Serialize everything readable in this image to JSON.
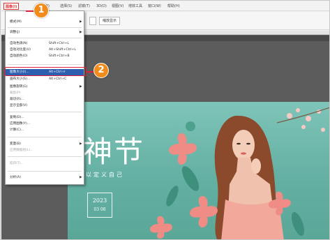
{
  "menubar": {
    "items": [
      {
        "label": "图像(I)",
        "active": true
      },
      {
        "label": "(Y)",
        "active": false
      },
      {
        "label": "选择(S)",
        "active": false
      },
      {
        "label": "滤镜(T)",
        "active": false
      },
      {
        "label": "3D(D)",
        "active": false
      },
      {
        "label": "视图(V)",
        "active": false
      },
      {
        "label": "增效工具",
        "active": false
      },
      {
        "label": "窗口(W)",
        "active": false
      },
      {
        "label": "帮助(H)",
        "active": false
      }
    ]
  },
  "optionsbar": {
    "button1": "",
    "button2": "缩放显示"
  },
  "image_menu": {
    "items": [
      {
        "label": "模式(M)",
        "shortcut": "",
        "submenu": true
      },
      {
        "type": "sep"
      },
      {
        "label": "调整(J)",
        "shortcut": "",
        "submenu": true
      },
      {
        "type": "sep"
      },
      {
        "label": "自动色调(N)",
        "shortcut": "Shift+Ctrl+L"
      },
      {
        "label": "自动对比度(U)",
        "shortcut": "Alt+Shift+Ctrl+L"
      },
      {
        "label": "自动颜色(O)",
        "shortcut": "Shift+Ctrl+B"
      },
      {
        "type": "sep"
      },
      {
        "label": "图像大小(I)...",
        "shortcut": "Alt+Ctrl+I",
        "highlight": true
      },
      {
        "label": "画布大小(S)...",
        "shortcut": "Alt+Ctrl+C"
      },
      {
        "label": "图像旋转(G)",
        "shortcut": "",
        "submenu": true
      },
      {
        "label": "裁剪(P)",
        "shortcut": "",
        "disabled": true
      },
      {
        "label": "裁切(R)...",
        "shortcut": ""
      },
      {
        "label": "显示全部(V)",
        "shortcut": ""
      },
      {
        "type": "sep"
      },
      {
        "label": "复制(D)...",
        "shortcut": ""
      },
      {
        "label": "应用图像(Y)...",
        "shortcut": ""
      },
      {
        "label": "计算(C)...",
        "shortcut": ""
      },
      {
        "type": "sep"
      },
      {
        "label": "变量(B)",
        "shortcut": "",
        "submenu": true
      },
      {
        "label": "应用数据组(L)...",
        "shortcut": "",
        "disabled": true
      },
      {
        "type": "sep"
      },
      {
        "label": "陷印(T)...",
        "shortcut": "",
        "disabled": true
      },
      {
        "type": "sep"
      },
      {
        "label": "分析(A)",
        "shortcut": "",
        "submenu": true
      }
    ]
  },
  "callouts": {
    "step1": "1",
    "step2": "2"
  },
  "artwork": {
    "title": "神节",
    "subtitle": "以定义自己",
    "year": "2023",
    "day": "03 08"
  },
  "colors": {
    "menu_highlight": "#2d5fb0",
    "callout": "#f08b1c",
    "outline": "#e0203a",
    "canvas_bg": "#64b0a3"
  }
}
